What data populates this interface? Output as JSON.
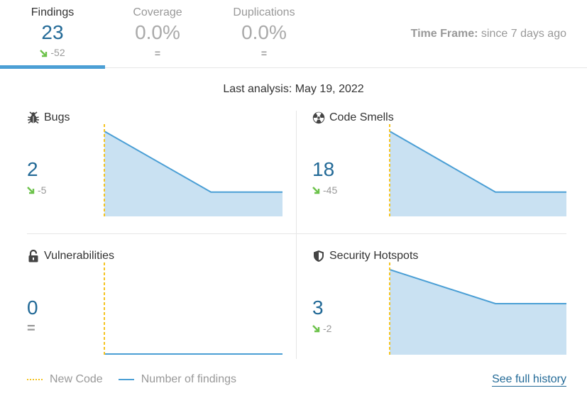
{
  "tabs": [
    {
      "label": "Findings",
      "value": "23",
      "delta": "-52",
      "delta_type": "down",
      "active": true
    },
    {
      "label": "Coverage",
      "value": "0.0%",
      "delta": "=",
      "delta_type": "equal",
      "active": false
    },
    {
      "label": "Duplications",
      "value": "0.0%",
      "delta": "=",
      "delta_type": "equal",
      "active": false
    }
  ],
  "time_frame": {
    "label": "Time Frame:",
    "value": "since 7 days ago"
  },
  "last_analysis": "Last analysis: May 19, 2022",
  "cards": [
    {
      "title": "Bugs",
      "icon": "bug-icon",
      "value": "2",
      "delta": "-5",
      "delta_type": "down",
      "history": [
        7,
        2,
        2
      ]
    },
    {
      "title": "Code Smells",
      "icon": "radioactive-icon",
      "value": "18",
      "delta": "-45",
      "delta_type": "down",
      "history": [
        63,
        18,
        18
      ]
    },
    {
      "title": "Vulnerabilities",
      "icon": "unlock-icon",
      "value": "0",
      "delta": "=",
      "delta_type": "equal",
      "history": [
        0,
        0,
        0
      ]
    },
    {
      "title": "Security Hotspots",
      "icon": "shield-icon",
      "value": "3",
      "delta": "-2",
      "delta_type": "down",
      "history": [
        5,
        3,
        3
      ]
    }
  ],
  "legend": {
    "new_code": "New Code",
    "number_of_findings": "Number of findings"
  },
  "history_link": "See full history",
  "colors": {
    "accent": "#236a97",
    "line": "#4b9fd5",
    "area": "#c9e1f2",
    "new_code": "#f4c320",
    "improved": "#6cc24a"
  }
}
